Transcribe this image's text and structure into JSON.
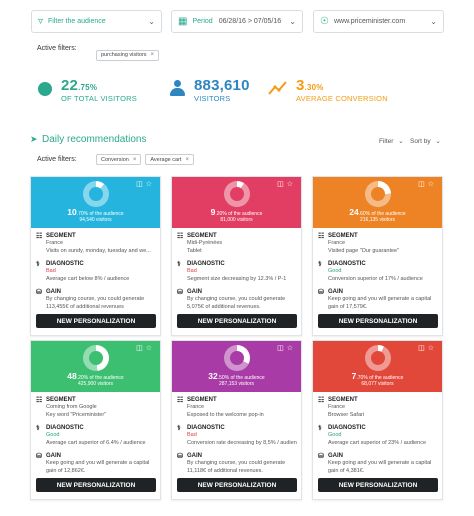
{
  "filters_bar": {
    "audience_label": "Filter the audience",
    "period_label": "Period",
    "period_value": "06/28/16 > 07/05/16",
    "site_value": "www.priceminister.com"
  },
  "active_filters_top": {
    "label": "Active filters:",
    "chip": "purchasing visitors"
  },
  "stats": [
    {
      "value": "22",
      "decimal": ".75%",
      "label": "OF TOTAL VISITORS",
      "color": "#2aa98e"
    },
    {
      "value": "883,610",
      "decimal": "",
      "label": "VISITORS",
      "color": "#2e86c1"
    },
    {
      "value": "3",
      "decimal": ".30%",
      "label": "AVERAGE CONVERSION",
      "color": "#f39c12"
    }
  ],
  "daily": {
    "title": "Daily recommendations",
    "filter_label": "Filter",
    "sort_label": "Sort by",
    "active_label": "Active filters:",
    "chips": [
      "Conversion",
      "Average cart"
    ]
  },
  "labels": {
    "segment": "SEGMENT",
    "diagnostic": "DIAGNOSTIC",
    "gain": "GAIN",
    "button": "NEW PERSONALIZATION"
  },
  "cards": [
    {
      "color": "#24b4dd",
      "pct_big": "10",
      "pct_rest": ".70% of the audience",
      "visitors": "94,540 visitors",
      "seg1": "France",
      "seg2": "Visits on sundy, monday, tuesday and we...",
      "diag": "Bad",
      "diag_type": "bad",
      "diag_text": "Average cart below 8% / audience",
      "gain1": "By changing course, you could generate",
      "gain2": "113,455€ of additional revenues"
    },
    {
      "color": "#e23e63",
      "pct_big": "9",
      "pct_rest": ".20% of the audience",
      "visitors": "81,000 visitors",
      "seg1": "Midi-Pyrénées",
      "seg2": "Tablet",
      "diag": "Bad",
      "diag_type": "bad",
      "diag_text": "Segment size decreasing by 12.3% / P-1",
      "gain1": "By changing course, you could generate",
      "gain2": "5,075€ of additional revenues."
    },
    {
      "color": "#ed8325",
      "pct_big": "24",
      "pct_rest": ".60% of the audience",
      "visitors": "216,135 visitors",
      "seg1": "France",
      "seg2": "Visited page \"Our guarantee\"",
      "diag": "Good",
      "diag_type": "good",
      "diag_text": "Conversion superior of 17% / audience",
      "gain1": "Keep going and you will generate a capital",
      "gain2": "gain of 17,579€."
    },
    {
      "color": "#3dbf72",
      "pct_big": "48",
      "pct_rest": ".20% of the audience",
      "visitors": "425,900 visitors",
      "seg1": "Coming from Google",
      "seg2": "Key word \"Priceminister\"",
      "diag": "Good",
      "diag_type": "good",
      "diag_text": "Average cart superior of 6.4% / audience",
      "gain1": "Keep going and you will generate a capital",
      "gain2": "gain of 12,862€."
    },
    {
      "color": "#a93ba6",
      "pct_big": "32",
      "pct_rest": ".50% of the audience",
      "visitors": "287,153 visitors",
      "seg1": "France",
      "seg2": "Exposed to the welcome pop-in",
      "diag": "Bad",
      "diag_type": "bad",
      "diag_text": "Conversion rate decreasing by 8,5% / audience",
      "gain1": "By changing course, you could generate",
      "gain2": "11,118€ of additional revenues."
    },
    {
      "color": "#e2483a",
      "pct_big": "7",
      "pct_rest": ".70% of the audience",
      "visitors": "68,077 visitors",
      "seg1": "France",
      "seg2": "Browser Safari",
      "diag": "Good",
      "diag_type": "good",
      "diag_text": "Average cart superior of 23% / audience",
      "gain1": "Keep going and you will generate a capital",
      "gain2": "gain of 4,381€."
    }
  ]
}
